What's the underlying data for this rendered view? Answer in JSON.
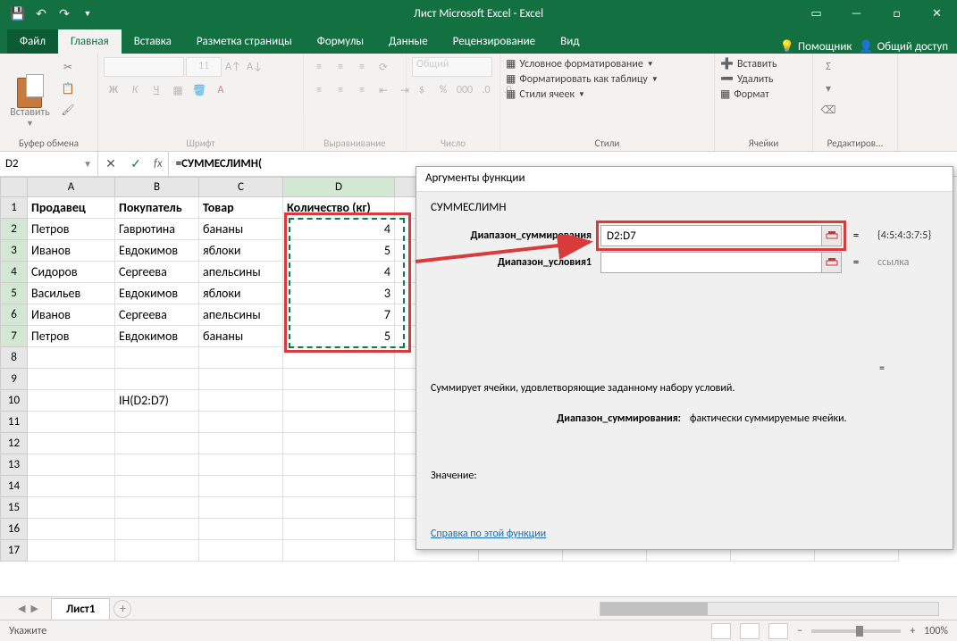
{
  "titlebar": {
    "title": "Лист Microsoft Excel - Excel"
  },
  "tabs": {
    "file": "Файл",
    "items": [
      "Главная",
      "Вставка",
      "Разметка страницы",
      "Формулы",
      "Данные",
      "Рецензирование",
      "Вид"
    ],
    "active_index": 0,
    "helper": "Помощник",
    "share": "Общий доступ"
  },
  "ribbon": {
    "clipboard": {
      "paste": "Вставить",
      "label": "Буфер обмена"
    },
    "font": {
      "label": "Шрифт",
      "size": "11",
      "bold": "Ж",
      "italic": "К",
      "underline": "Ч"
    },
    "alignment": {
      "label": "Выравнивание"
    },
    "number": {
      "label": "Число",
      "format": "Общий"
    },
    "styles": {
      "label": "Стили",
      "cond": "Условное форматирование",
      "table": "Форматировать как таблицу",
      "cell": "Стили ячеек"
    },
    "cells": {
      "label": "Ячейки",
      "insert": "Вставить",
      "delete": "Удалить",
      "format": "Формат"
    },
    "editing": {
      "label": "Редактиров..."
    }
  },
  "formula_bar": {
    "name_box": "D2",
    "formula": "=СУММЕСЛИМН("
  },
  "grid": {
    "columns": [
      "A",
      "B",
      "C",
      "D"
    ],
    "headers": [
      "Продавец",
      "Покупатель",
      "Товар",
      "Количество (кг)"
    ],
    "rows": [
      [
        "Петров",
        "Гаврютина",
        "бананы",
        "4"
      ],
      [
        "Иванов",
        "Евдокимов",
        "яблоки",
        "5"
      ],
      [
        "Сидоров",
        "Сергеева",
        "апельсины",
        "4"
      ],
      [
        "Васильев",
        "Евдокимов",
        "яблоки",
        "3"
      ],
      [
        "Иванов",
        "Сергеева",
        "апельсины",
        "7"
      ],
      [
        "Петров",
        "Евдокимов",
        "бананы",
        "5"
      ]
    ],
    "b10": "ІН(D2:D7)",
    "row_count": 17
  },
  "dialog": {
    "title": "Аргументы функции",
    "func_name": "СУММЕСЛИМН",
    "arg1_label": "Диапазон_суммирования",
    "arg1_value": "D2:D7",
    "arg1_result": "{4:5:4:3:7:5}",
    "arg2_label": "Диапазон_условия1",
    "arg2_value": "",
    "arg2_result": "ссылка",
    "desc": "Суммирует ячейки, удовлетворяющие заданному набору условий.",
    "arg_desc_label": "Диапазон_суммирования:",
    "arg_desc_text": "фактически суммируемые ячейки.",
    "value_label": "Значение:",
    "help_link": "Справка по этой функции",
    "eq": "="
  },
  "sheet": {
    "tab1": "Лист1"
  },
  "status": {
    "left": "Укажите",
    "zoom": "100%"
  },
  "chart_data": {
    "type": "table",
    "title": "Sales data",
    "columns": [
      "Продавец",
      "Покупатель",
      "Товар",
      "Количество (кг)"
    ],
    "rows": [
      [
        "Петров",
        "Гаврютина",
        "бананы",
        4
      ],
      [
        "Иванов",
        "Евдокимов",
        "яблоки",
        5
      ],
      [
        "Сидоров",
        "Сергеева",
        "апельсины",
        4
      ],
      [
        "Васильев",
        "Евдокимов",
        "яблоки",
        3
      ],
      [
        "Иванов",
        "Сергеева",
        "апельсины",
        7
      ],
      [
        "Петров",
        "Евдокимов",
        "бананы",
        5
      ]
    ]
  }
}
